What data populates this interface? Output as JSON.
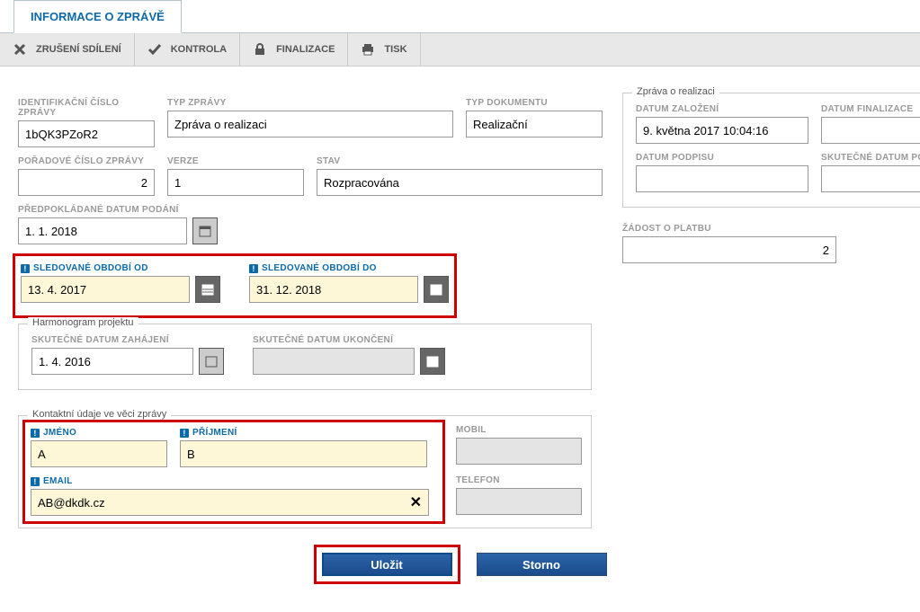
{
  "tab": {
    "title": "INFORMACE O ZPRÁVĚ"
  },
  "toolbar": {
    "cancel_share": "ZRUŠENÍ SDÍLENÍ",
    "kontrola": "KONTROLA",
    "finalizace": "FINALIZACE",
    "tisk": "TISK"
  },
  "labels": {
    "id_zpravy": "IDENTIFIKAČNÍ ČÍSLO ZPRÁVY",
    "typ_zpravy": "TYP ZPRÁVY",
    "typ_dokumentu": "TYP DOKUMENTU",
    "poradove": "POŘADOVÉ ČÍSLO ZPRÁVY",
    "verze": "VERZE",
    "stav": "STAV",
    "predpokl": "PŘEDPOKLÁDANÉ DATUM PODÁNÍ",
    "sled_od": "SLEDOVANÉ OBDOBÍ OD",
    "sled_do": "SLEDOVANÉ OBDOBÍ DO",
    "harmonogram": "Harmonogram projektu",
    "skut_zahaj": "SKUTEČNÉ DATUM ZAHÁJENÍ",
    "skut_ukon": "SKUTEČNÉ DATUM UKONČENÍ",
    "kontakt": "Kontaktní údaje ve věci zprávy",
    "jmeno": "JMÉNO",
    "prijmeni": "PŘÍJMENÍ",
    "mobil": "MOBIL",
    "email": "EMAIL",
    "telefon": "TELEFON",
    "zprava_real": "Zpráva o realizaci",
    "datum_zalozeni": "DATUM ZALOŽENÍ",
    "datum_finalizace": "DATUM FINALIZACE",
    "datum_podpisu": "DATUM PODPISU",
    "skut_podani": "SKUTEČNÉ DATUM PODÁNÍ",
    "zadost": "ŽÁDOST O PLATBU"
  },
  "values": {
    "id_zpravy": "1bQK3PZoR2",
    "typ_zpravy": "Zpráva o realizaci",
    "typ_dokumentu": "Realizační",
    "poradove": "2",
    "verze": "1",
    "stav": "Rozpracována",
    "predpokl": "1. 1. 2018",
    "sled_od": "13. 4. 2017",
    "sled_do": "31. 12. 2018",
    "skut_zahaj": "1. 4. 2016",
    "skut_ukon": "",
    "jmeno": "A",
    "prijmeni": "B",
    "mobil": "",
    "email": "AB@dkdk.cz",
    "telefon": "",
    "datum_zalozeni": "9. května 2017 10:04:16",
    "datum_finalizace": "",
    "datum_podpisu": "",
    "skut_podani": "",
    "zadost": "2"
  },
  "buttons": {
    "save": "Uložit",
    "cancel": "Storno"
  }
}
